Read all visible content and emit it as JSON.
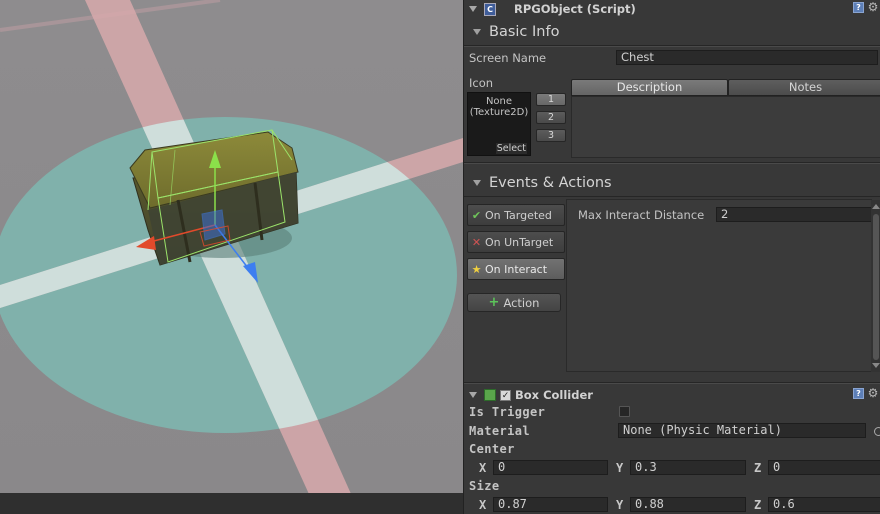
{
  "rpg_object": {
    "title": "RPGObject (Script)",
    "basic_info": {
      "section_title": "Basic Info",
      "screen_name_label": "Screen Name",
      "screen_name_value": "Chest",
      "icon_label": "Icon",
      "icon_value": "None\n(Texture2D)",
      "select_label": "Select",
      "icon_slots": [
        "1",
        "2",
        "3"
      ],
      "tabs": [
        "Description",
        "Notes"
      ],
      "active_tab": "Description"
    },
    "events": {
      "section_title": "Events & Actions",
      "buttons": [
        {
          "label": "On Targeted",
          "icon": "check-icon",
          "color": "#6fc45a"
        },
        {
          "label": "On UnTarget",
          "icon": "x-icon",
          "color": "#d05353"
        },
        {
          "label": "On Interact",
          "icon": "star-icon",
          "color": "#f0d040"
        }
      ],
      "active_button": "On Interact",
      "action_button": "Action",
      "max_interact_label": "Max Interact Distance",
      "max_interact_value": "2"
    }
  },
  "box_collider": {
    "title": "Box Collider",
    "enabled": true,
    "is_trigger_label": "Is Trigger",
    "is_trigger": false,
    "material_label": "Material",
    "material_value": "None (Physic Material)",
    "center_label": "Center",
    "center": {
      "x": "0",
      "y": "0.3",
      "z": "0"
    },
    "size_label": "Size",
    "size": {
      "x": "0.87",
      "y": "0.88",
      "z": "0.6"
    },
    "axis_labels": {
      "x": "X",
      "y": "Y",
      "z": "Z"
    }
  },
  "colors": {
    "inspector_bg": "#383838",
    "field_bg": "#2a2a2a",
    "scene_floor": "#8c8a8c",
    "trigger_sphere": "#7fb3ad",
    "gizmo_x": "#e24a2b",
    "gizmo_y": "#8be04a",
    "gizmo_z": "#3d7ef0"
  }
}
